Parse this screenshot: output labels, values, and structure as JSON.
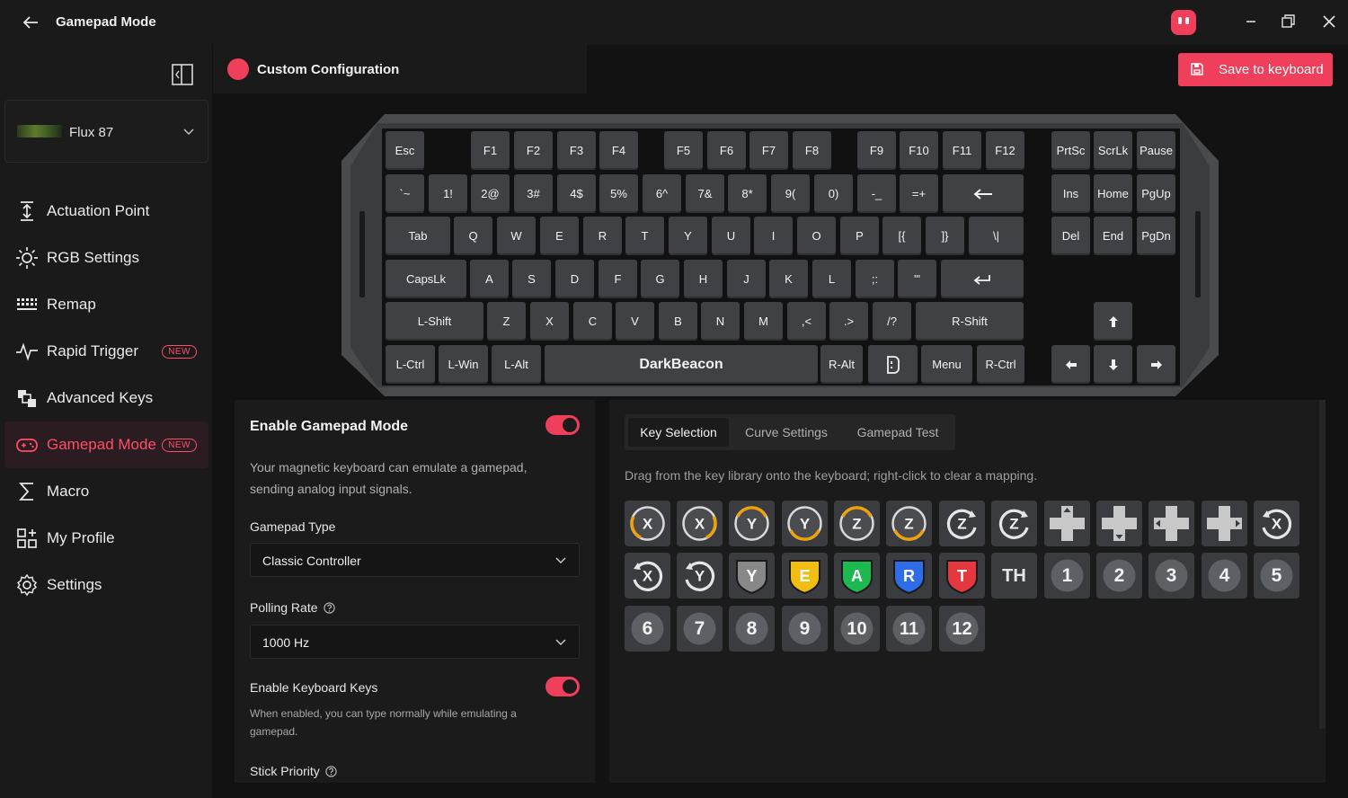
{
  "app": {
    "title": "Gamepad Mode"
  },
  "sidebar": {
    "device": "Flux 87",
    "items": [
      {
        "label": "Actuation Point",
        "icon": "actuation-icon",
        "badge": ""
      },
      {
        "label": "RGB Settings",
        "icon": "sun-icon",
        "badge": ""
      },
      {
        "label": "Remap",
        "icon": "keyboard-icon",
        "badge": ""
      },
      {
        "label": "Rapid Trigger",
        "icon": "pulse-icon",
        "badge": "NEW"
      },
      {
        "label": "Advanced Keys",
        "icon": "advanced-keys-icon",
        "badge": ""
      },
      {
        "label": "Gamepad Mode",
        "icon": "gamepad-icon",
        "badge": "NEW",
        "active": true
      },
      {
        "label": "Macro",
        "icon": "sigma-icon",
        "badge": ""
      },
      {
        "label": "My Profile",
        "icon": "profile-grid-icon",
        "badge": ""
      },
      {
        "label": "Settings",
        "icon": "gear-icon",
        "badge": ""
      }
    ]
  },
  "header": {
    "config_name": "Custom Configuration",
    "save_label": "Save to keyboard"
  },
  "keyboard": {
    "rows": [
      [
        "Esc",
        "F1",
        "F2",
        "F3",
        "F4",
        "F5",
        "F6",
        "F7",
        "F8",
        "F9",
        "F10",
        "F11",
        "F12",
        "PrtSc",
        "ScrLk",
        "Pause"
      ],
      [
        "`~",
        "1!",
        "2@",
        "3#",
        "4$",
        "5%",
        "6^",
        "7&",
        "8*",
        "9(",
        "0)",
        "-_",
        "=+",
        "←",
        "Ins",
        "Home",
        "PgUp"
      ],
      [
        "Tab",
        "Q",
        "W",
        "E",
        "R",
        "T",
        "Y",
        "U",
        "I",
        "O",
        "P",
        "[{",
        "]}",
        "\\|",
        "Del",
        "End",
        "PgDn"
      ],
      [
        "CapsLk",
        "A",
        "S",
        "D",
        "F",
        "G",
        "H",
        "J",
        "K",
        "L",
        ";:",
        "'\"",
        "↵"
      ],
      [
        "L-Shift",
        "Z",
        "X",
        "C",
        "V",
        "B",
        "N",
        "M",
        ",<",
        ".>",
        "/?",
        "R-Shift",
        "↑"
      ],
      [
        "L-Ctrl",
        "L-Win",
        "L-Alt",
        "DarkBeacon",
        "R-Alt",
        "",
        "Menu",
        "R-Ctrl",
        "←",
        "↓",
        "→"
      ]
    ]
  },
  "gamepad": {
    "title": "Enable Gamepad Mode",
    "enabled": true,
    "description": "Your magnetic keyboard can emulate a gamepad, sending analog input signals.",
    "type_label": "Gamepad Type",
    "type_value": "Classic Controller",
    "polling_label": "Polling Rate",
    "polling_value": "1000 Hz",
    "kb_keys_label": "Enable Keyboard Keys",
    "kb_keys_enabled": true,
    "kb_keys_desc": "When enabled, you can type normally while emulating a gamepad.",
    "stick_label": "Stick Priority"
  },
  "library": {
    "tabs": [
      "Key Selection",
      "Curve Settings",
      "Gamepad Test"
    ],
    "active_tab": "Key Selection",
    "instruction": "Drag from the key library onto the keyboard; right-click to clear a mapping.",
    "colors": {
      "accent": "#ef3f5b",
      "orange": "#f2a100",
      "yellow": "#f2bd11",
      "green": "#1db84f",
      "blue": "#2f6de8",
      "red": "#e5383e"
    },
    "buttons": [
      "X",
      "X",
      "Y",
      "Y",
      "Z",
      "Z",
      "Z",
      "Z",
      "dpad-up",
      "dpad-down",
      "dpad-left",
      "dpad-right",
      "X",
      "X",
      "Y",
      "Y",
      "E",
      "A",
      "R",
      "T",
      "TH",
      "1",
      "2",
      "3",
      "4",
      "5",
      "6",
      "7",
      "8",
      "9",
      "10",
      "11",
      "12"
    ]
  }
}
